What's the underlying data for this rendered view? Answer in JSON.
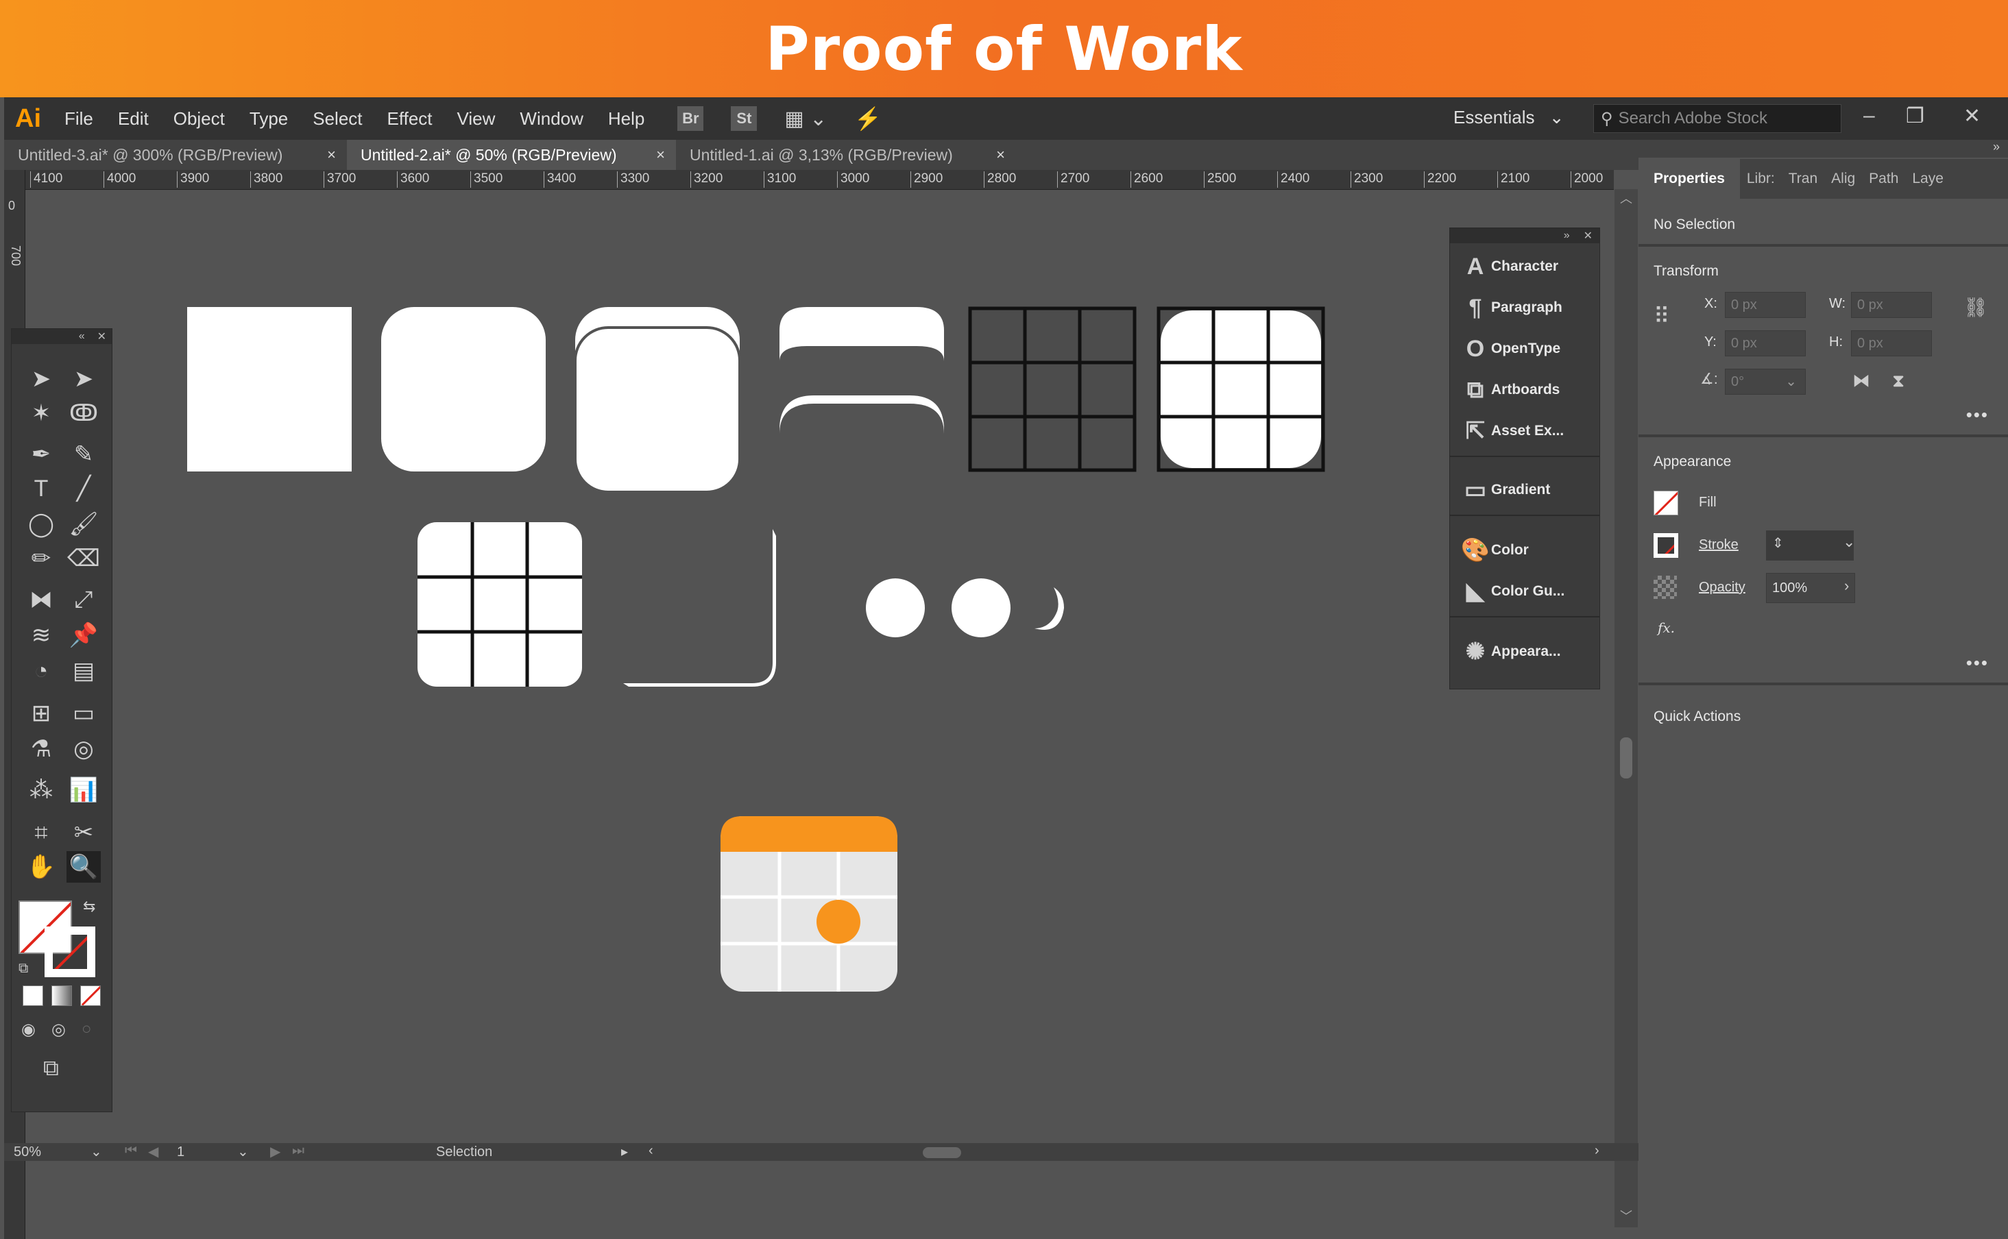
{
  "banner": {
    "title": "Proof of Work"
  },
  "app": {
    "logo": "Ai",
    "menu": [
      "File",
      "Edit",
      "Object",
      "Type",
      "Select",
      "Effect",
      "View",
      "Window",
      "Help"
    ],
    "bridge_label": "Br",
    "stock_label": "St",
    "workspace": "Essentials",
    "search_placeholder": "Search Adobe Stock"
  },
  "tabs": [
    {
      "label": "Untitled-3.ai* @ 300% (RGB/Preview)",
      "close": "×"
    },
    {
      "label": "Untitled-2.ai* @ 50% (RGB/Preview)",
      "close": "×"
    },
    {
      "label": "Untitled-1.ai @ 3,13% (RGB/Preview)",
      "close": "×"
    }
  ],
  "ruler": {
    "h_ticks": [
      "4100",
      "4000",
      "3900",
      "3800",
      "3700",
      "3600",
      "3500",
      "3400",
      "3300",
      "3200",
      "3100",
      "3000",
      "2900",
      "2800",
      "2700",
      "2600",
      "2500",
      "2400",
      "2300",
      "2200",
      "2100",
      "2000"
    ],
    "v_ticks": [
      "0",
      "700"
    ]
  },
  "floating_panel": {
    "items": [
      "Character",
      "Paragraph",
      "OpenType",
      "Artboards",
      "Asset Ex...",
      "Gradient",
      "Color",
      "Color Gu...",
      "Appeara..."
    ]
  },
  "properties": {
    "tabs": [
      "Properties",
      "Libr:",
      "Tran",
      "Alig",
      "Path",
      "Laye"
    ],
    "no_selection": "No Selection",
    "transform_title": "Transform",
    "x_label": "X:",
    "y_label": "Y:",
    "w_label": "W:",
    "h_label": "H:",
    "x_value": "0 px",
    "y_value": "0 px",
    "w_value": "0 px",
    "h_value": "0 px",
    "angle_value": "0°",
    "appearance_title": "Appearance",
    "fill_label": "Fill",
    "stroke_label": "Stroke",
    "opacity_label": "Opacity",
    "opacity_value": "100%",
    "fx_label": "fx.",
    "quick_actions_title": "Quick Actions"
  },
  "status": {
    "zoom": "50%",
    "artboard": "1",
    "tool": "Selection"
  },
  "colors": {
    "accent": "#f7941d",
    "artwork_light": "#e6e6e6",
    "tile": "#ffffff"
  }
}
